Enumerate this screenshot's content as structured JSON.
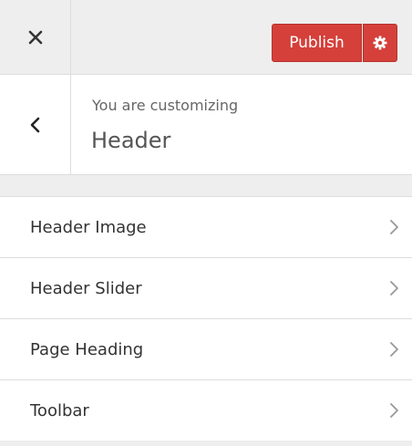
{
  "topbar": {
    "close_icon": "close-icon",
    "publish_label": "Publish",
    "settings_icon": "gear-icon",
    "accent_color": "#d5403a"
  },
  "info": {
    "back_icon": "chevron-left-icon",
    "customizing_label": "You are customizing",
    "section_title": "Header"
  },
  "menu": {
    "items": [
      {
        "label": "Header Image",
        "icon": "chevron-right-icon"
      },
      {
        "label": "Header Slider",
        "icon": "chevron-right-icon"
      },
      {
        "label": "Page Heading",
        "icon": "chevron-right-icon"
      },
      {
        "label": "Toolbar",
        "icon": "chevron-right-icon"
      }
    ]
  }
}
